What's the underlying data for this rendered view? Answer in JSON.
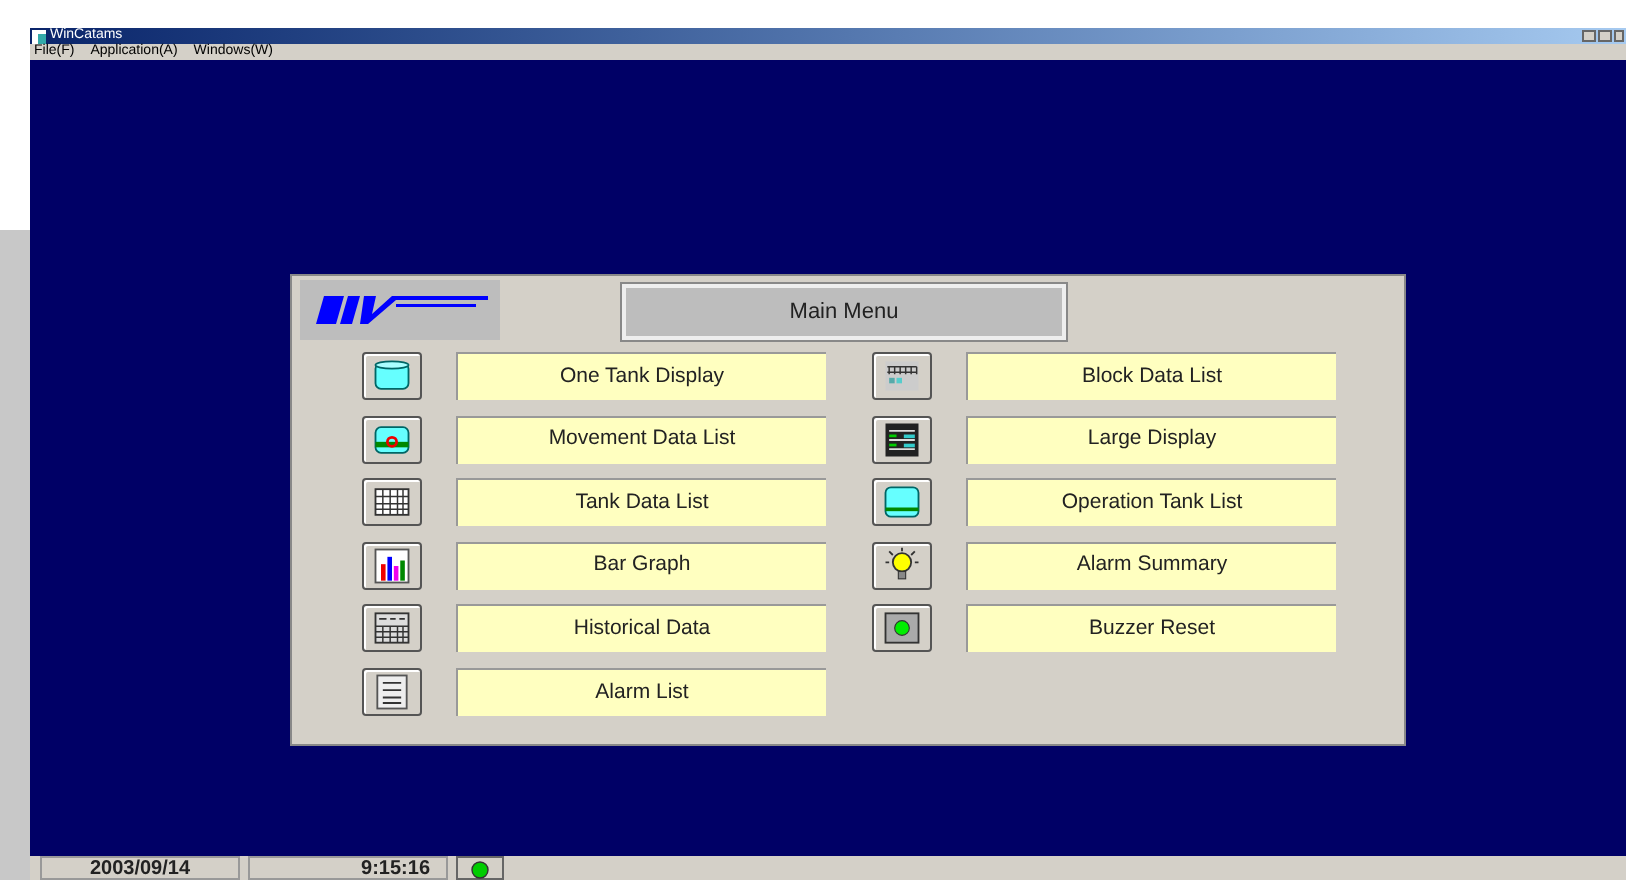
{
  "window": {
    "title": "WinCatams"
  },
  "menu": [
    "File(F)",
    "Application(A)",
    "Windows(W)"
  ],
  "main_menu": {
    "title": "Main Menu",
    "left": [
      {
        "label": "One Tank Display",
        "kind": "tank"
      },
      {
        "label": "Movement Data List",
        "kind": "movement"
      },
      {
        "label": "Tank Data List",
        "kind": "grid"
      },
      {
        "label": "Bar Graph",
        "kind": "bars"
      },
      {
        "label": "Historical Data",
        "kind": "history"
      },
      {
        "label": "Alarm List",
        "kind": "list"
      }
    ],
    "right": [
      {
        "label": "Block Data List",
        "kind": "block"
      },
      {
        "label": "Large Display",
        "kind": "large"
      },
      {
        "label": "Operation Tank List",
        "kind": "optank"
      },
      {
        "label": "Alarm Summary",
        "kind": "bulb"
      },
      {
        "label": "Buzzer Reset",
        "kind": "buzzer"
      }
    ]
  },
  "status_bar": {
    "date": "2003/09/14",
    "time": "9:15:16"
  }
}
